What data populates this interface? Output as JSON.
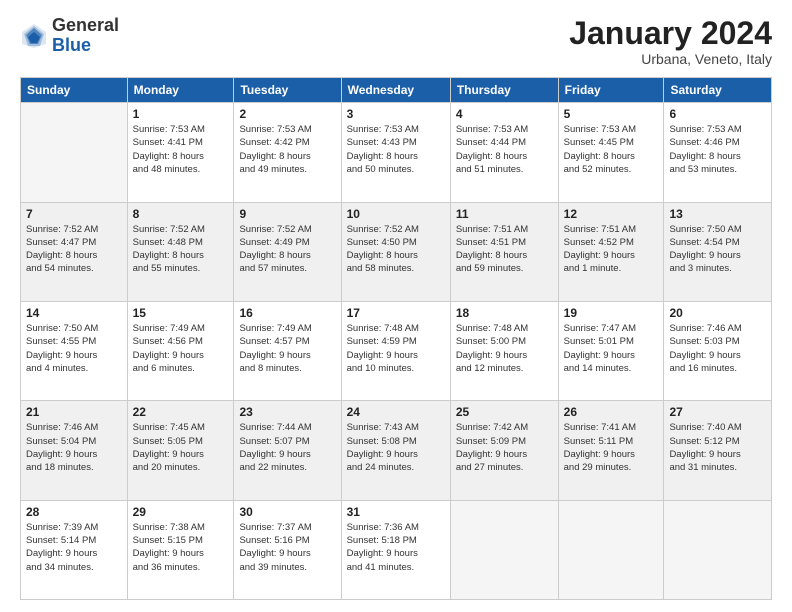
{
  "header": {
    "logo_general": "General",
    "logo_blue": "Blue",
    "month_title": "January 2024",
    "subtitle": "Urbana, Veneto, Italy"
  },
  "days_of_week": [
    "Sunday",
    "Monday",
    "Tuesday",
    "Wednesday",
    "Thursday",
    "Friday",
    "Saturday"
  ],
  "weeks": [
    [
      {
        "day": "",
        "info": ""
      },
      {
        "day": "1",
        "info": "Sunrise: 7:53 AM\nSunset: 4:41 PM\nDaylight: 8 hours\nand 48 minutes."
      },
      {
        "day": "2",
        "info": "Sunrise: 7:53 AM\nSunset: 4:42 PM\nDaylight: 8 hours\nand 49 minutes."
      },
      {
        "day": "3",
        "info": "Sunrise: 7:53 AM\nSunset: 4:43 PM\nDaylight: 8 hours\nand 50 minutes."
      },
      {
        "day": "4",
        "info": "Sunrise: 7:53 AM\nSunset: 4:44 PM\nDaylight: 8 hours\nand 51 minutes."
      },
      {
        "day": "5",
        "info": "Sunrise: 7:53 AM\nSunset: 4:45 PM\nDaylight: 8 hours\nand 52 minutes."
      },
      {
        "day": "6",
        "info": "Sunrise: 7:53 AM\nSunset: 4:46 PM\nDaylight: 8 hours\nand 53 minutes."
      }
    ],
    [
      {
        "day": "7",
        "info": "Sunrise: 7:52 AM\nSunset: 4:47 PM\nDaylight: 8 hours\nand 54 minutes."
      },
      {
        "day": "8",
        "info": "Sunrise: 7:52 AM\nSunset: 4:48 PM\nDaylight: 8 hours\nand 55 minutes."
      },
      {
        "day": "9",
        "info": "Sunrise: 7:52 AM\nSunset: 4:49 PM\nDaylight: 8 hours\nand 57 minutes."
      },
      {
        "day": "10",
        "info": "Sunrise: 7:52 AM\nSunset: 4:50 PM\nDaylight: 8 hours\nand 58 minutes."
      },
      {
        "day": "11",
        "info": "Sunrise: 7:51 AM\nSunset: 4:51 PM\nDaylight: 8 hours\nand 59 minutes."
      },
      {
        "day": "12",
        "info": "Sunrise: 7:51 AM\nSunset: 4:52 PM\nDaylight: 9 hours\nand 1 minute."
      },
      {
        "day": "13",
        "info": "Sunrise: 7:50 AM\nSunset: 4:54 PM\nDaylight: 9 hours\nand 3 minutes."
      }
    ],
    [
      {
        "day": "14",
        "info": "Sunrise: 7:50 AM\nSunset: 4:55 PM\nDaylight: 9 hours\nand 4 minutes."
      },
      {
        "day": "15",
        "info": "Sunrise: 7:49 AM\nSunset: 4:56 PM\nDaylight: 9 hours\nand 6 minutes."
      },
      {
        "day": "16",
        "info": "Sunrise: 7:49 AM\nSunset: 4:57 PM\nDaylight: 9 hours\nand 8 minutes."
      },
      {
        "day": "17",
        "info": "Sunrise: 7:48 AM\nSunset: 4:59 PM\nDaylight: 9 hours\nand 10 minutes."
      },
      {
        "day": "18",
        "info": "Sunrise: 7:48 AM\nSunset: 5:00 PM\nDaylight: 9 hours\nand 12 minutes."
      },
      {
        "day": "19",
        "info": "Sunrise: 7:47 AM\nSunset: 5:01 PM\nDaylight: 9 hours\nand 14 minutes."
      },
      {
        "day": "20",
        "info": "Sunrise: 7:46 AM\nSunset: 5:03 PM\nDaylight: 9 hours\nand 16 minutes."
      }
    ],
    [
      {
        "day": "21",
        "info": "Sunrise: 7:46 AM\nSunset: 5:04 PM\nDaylight: 9 hours\nand 18 minutes."
      },
      {
        "day": "22",
        "info": "Sunrise: 7:45 AM\nSunset: 5:05 PM\nDaylight: 9 hours\nand 20 minutes."
      },
      {
        "day": "23",
        "info": "Sunrise: 7:44 AM\nSunset: 5:07 PM\nDaylight: 9 hours\nand 22 minutes."
      },
      {
        "day": "24",
        "info": "Sunrise: 7:43 AM\nSunset: 5:08 PM\nDaylight: 9 hours\nand 24 minutes."
      },
      {
        "day": "25",
        "info": "Sunrise: 7:42 AM\nSunset: 5:09 PM\nDaylight: 9 hours\nand 27 minutes."
      },
      {
        "day": "26",
        "info": "Sunrise: 7:41 AM\nSunset: 5:11 PM\nDaylight: 9 hours\nand 29 minutes."
      },
      {
        "day": "27",
        "info": "Sunrise: 7:40 AM\nSunset: 5:12 PM\nDaylight: 9 hours\nand 31 minutes."
      }
    ],
    [
      {
        "day": "28",
        "info": "Sunrise: 7:39 AM\nSunset: 5:14 PM\nDaylight: 9 hours\nand 34 minutes."
      },
      {
        "day": "29",
        "info": "Sunrise: 7:38 AM\nSunset: 5:15 PM\nDaylight: 9 hours\nand 36 minutes."
      },
      {
        "day": "30",
        "info": "Sunrise: 7:37 AM\nSunset: 5:16 PM\nDaylight: 9 hours\nand 39 minutes."
      },
      {
        "day": "31",
        "info": "Sunrise: 7:36 AM\nSunset: 5:18 PM\nDaylight: 9 hours\nand 41 minutes."
      },
      {
        "day": "",
        "info": ""
      },
      {
        "day": "",
        "info": ""
      },
      {
        "day": "",
        "info": ""
      }
    ]
  ]
}
